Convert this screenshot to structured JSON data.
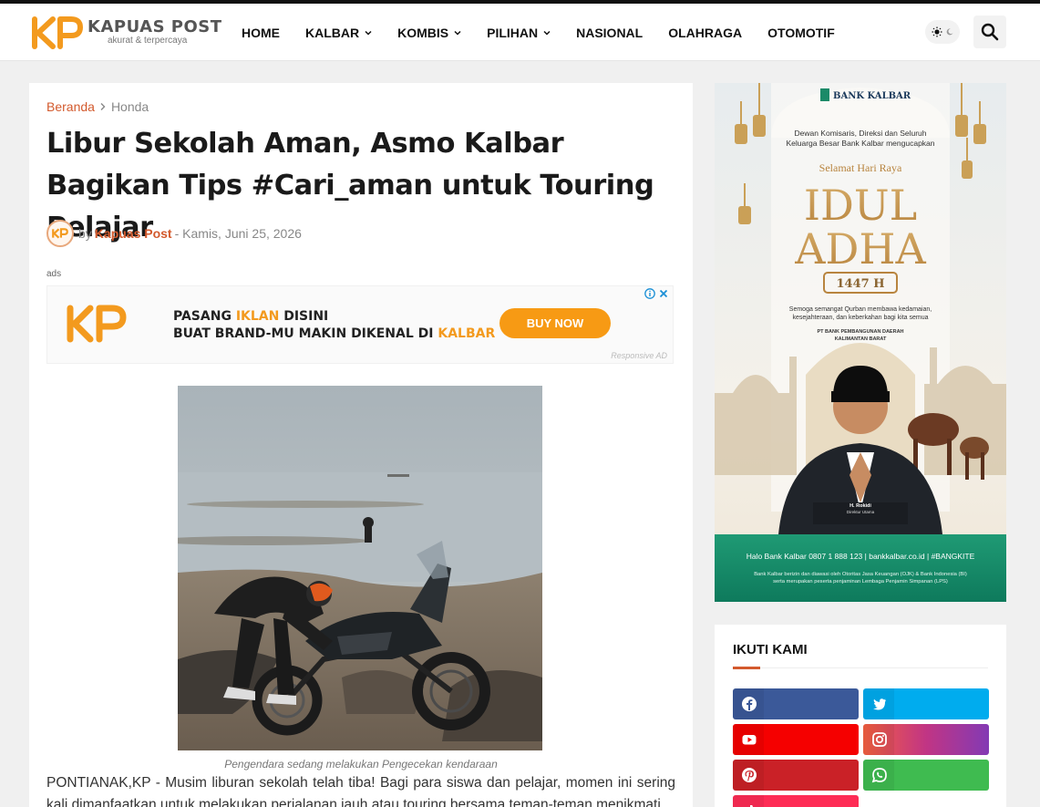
{
  "site": {
    "logo_letters": "KP",
    "name": "KAPUAS POST",
    "tagline": "akurat & terpercaya"
  },
  "nav": {
    "items": [
      {
        "label": "HOME",
        "dropdown": false
      },
      {
        "label": "KALBAR",
        "dropdown": true
      },
      {
        "label": "KOMBIS",
        "dropdown": true
      },
      {
        "label": "PILIHAN",
        "dropdown": true
      },
      {
        "label": "NASIONAL",
        "dropdown": false
      },
      {
        "label": "OLAHRAGA",
        "dropdown": false
      },
      {
        "label": "OTOMOTIF",
        "dropdown": false
      }
    ],
    "theme_icon": "sun-moon-icon",
    "search_icon": "search-icon"
  },
  "breadcrumb": {
    "home": "Beranda",
    "separator_icon": "chevron-right-icon",
    "current": "Honda"
  },
  "article": {
    "title": "Libur Sekolah Aman, Asmo Kalbar Bagikan Tips #Cari_aman untuk Touring Pelajar",
    "by": "by",
    "author": "Kapuas Post",
    "date": "- Kamis, Juni 25, 2026",
    "ads_label": "ads",
    "image_caption": "Pengendara sedang melakukan Pengecekan kendaraan",
    "paragraph": "PONTIANAK,KP - Musim liburan sekolah telah tiba! Bagi para siswa dan pelajar, momen ini sering kali dimanfaatkan untuk melakukan perjalanan jauh atau touring bersama teman-teman menikmati"
  },
  "ad_banner": {
    "logo_letters": "KP",
    "line1_prefix": "PASANG ",
    "line1_highlight": "IKLAN",
    "line1_suffix": " DISINI",
    "line2_prefix": "BUAT BRAND-MU MAKIN DIKENAL DI ",
    "line2_highlight": "KALBAR",
    "button": "BUY NOW",
    "responsive_label": "Responsive AD"
  },
  "sidebar_ad": {
    "bank": "BANK KALBAR",
    "greeting": "Dewan Komisaris, Direksi dan Seluruh Keluarga Besar Bank Kalbar mengucapkan",
    "selamat": "Selamat Hari Raya",
    "line1": "IDUL",
    "line2": "ADHA",
    "year": "1447 H",
    "wish": "Semoga semangat Qurban membawa kedamaian, kesejahteraan, dan keberkahan bagi kita semua",
    "company": "PT BANK PEMBANGUNAN DAERAH KALIMANTAN BARAT",
    "person": "H. Rokidi",
    "role": "Direktur Utama",
    "footer": "Halo Bank Kalbar 0807 1 888 123 | bankkalbar.co.id | #BANGKITE",
    "footer_note": "Bank Kalbar berizin dan diawasi oleh Otoritas Jasa Keuangan (OJK) & Bank Indonesia (BI) serta merupakan peserta penjaminan Lembaga Penjamin Simpanan (LPS)"
  },
  "follow": {
    "title": "IKUTI KAMI",
    "buttons": [
      {
        "network": "facebook",
        "icon": "facebook-icon",
        "color": "#3b5999"
      },
      {
        "network": "twitter",
        "icon": "twitter-icon",
        "color": "#00acee"
      },
      {
        "network": "youtube",
        "icon": "youtube-icon",
        "color": "#f50000"
      },
      {
        "network": "instagram",
        "icon": "instagram-icon",
        "color": "#dd2a7b"
      },
      {
        "network": "pinterest",
        "icon": "pinterest-icon",
        "color": "#ca2127"
      },
      {
        "network": "whatsapp",
        "icon": "whatsapp-icon",
        "color": "#3fbb50"
      },
      {
        "network": "tiktok",
        "icon": "tiktok-icon",
        "color": "#fe2c55"
      }
    ]
  },
  "colors": {
    "accent": "#d35a2d",
    "logo_orange": "#f39a1e",
    "ad_button": "#f79a14"
  }
}
